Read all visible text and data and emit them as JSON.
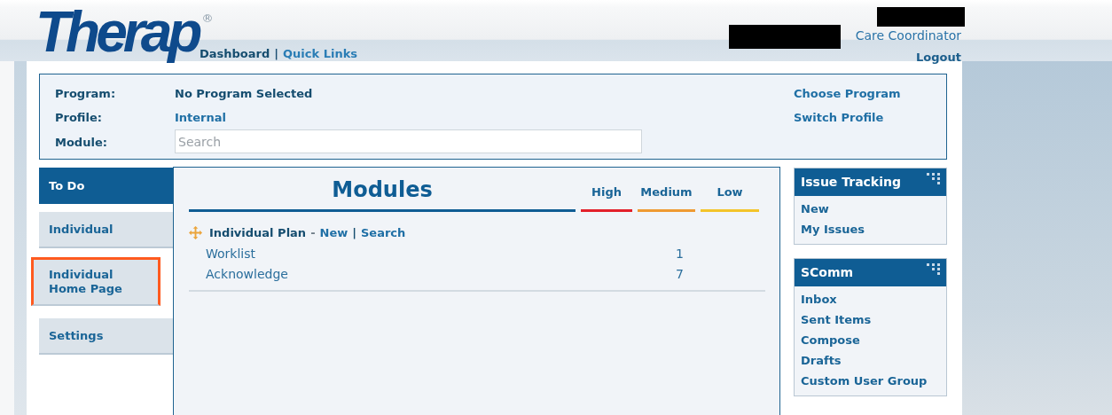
{
  "header": {
    "logo": "Therap",
    "logo_mark": "®",
    "nav": [
      {
        "label": "Dashboard",
        "selected": true
      },
      {
        "label": "Quick Links",
        "selected": false
      }
    ],
    "nav_separator": "|",
    "user_role": "Care Coordinator",
    "logout": "Logout"
  },
  "context": {
    "fields": [
      {
        "kind": "text",
        "label": "Program:",
        "value": "No Program Selected"
      },
      {
        "kind": "link",
        "label": "Profile:",
        "value": "Internal"
      },
      {
        "kind": "input",
        "label": "Module:",
        "placeholder": "Search"
      }
    ],
    "links": [
      "Choose Program",
      "Switch Profile"
    ]
  },
  "sidebar": {
    "items": [
      {
        "label": "To Do",
        "selected": true,
        "highlighted": false
      },
      {
        "label": "Individual",
        "selected": false,
        "highlighted": false
      },
      {
        "label": "Individual Home Page",
        "selected": false,
        "highlighted": true
      },
      {
        "label": "Settings",
        "selected": false,
        "highlighted": false
      }
    ]
  },
  "modules": {
    "title": "Modules",
    "priorities": [
      {
        "label": "High",
        "color": "#e3202a"
      },
      {
        "label": "Medium",
        "color": "#ef9a32"
      },
      {
        "label": "Low",
        "color": "#f3c42a"
      }
    ],
    "groups": [
      {
        "name": "Individual Plan",
        "dash": "-",
        "actions": [
          "New",
          "Search"
        ],
        "action_separator": "|",
        "items": [
          {
            "label": "Worklist",
            "medium_count": "1"
          },
          {
            "label": "Acknowledge",
            "medium_count": "7"
          }
        ]
      }
    ]
  },
  "widgets": [
    {
      "title": "Issue Tracking",
      "links": [
        "New",
        "My Issues"
      ]
    },
    {
      "title": "SComm",
      "links": [
        "Inbox",
        "Sent Items",
        "Compose",
        "Drafts",
        "Custom User Group"
      ]
    }
  ]
}
